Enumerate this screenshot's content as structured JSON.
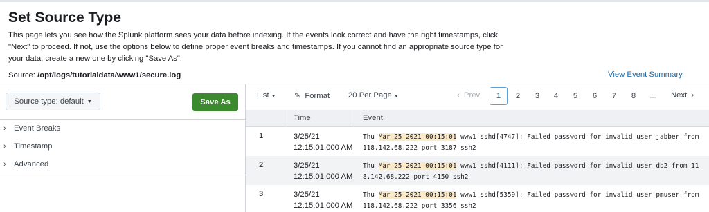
{
  "header": {
    "title": "Set Source Type",
    "description_lines": [
      "This page lets you see how the Splunk platform sees your data before indexing. If the events look correct and have the right timestamps, click",
      "\"Next\" to proceed. If not, use the options below to define proper event breaks and timestamps. If you cannot find an appropriate source type for",
      "your data, create a new one by clicking \"Save As\"."
    ],
    "source_label": "Source:",
    "source_path": "/opt/logs/tutorialdata/www1/secure.log",
    "view_summary_label": "View Event Summary"
  },
  "left_panel": {
    "source_type_label": "Source type: default",
    "save_as_label": "Save As",
    "accordion": [
      {
        "label": "Event Breaks"
      },
      {
        "label": "Timestamp"
      },
      {
        "label": "Advanced"
      }
    ]
  },
  "toolbar": {
    "list_label": "List",
    "format_label": "Format",
    "per_page_label": "20 Per Page",
    "prev_label": "Prev",
    "pages": [
      "1",
      "2",
      "3",
      "4",
      "5",
      "6",
      "7",
      "8"
    ],
    "ellipsis": "...",
    "next_label": "Next",
    "active_page": "1"
  },
  "table": {
    "columns": [
      "Time",
      "Event"
    ],
    "rows": [
      {
        "index": "1",
        "time_date": "3/25/21",
        "time_clock": "12:15:01.000 AM",
        "event_prefix": "Thu ",
        "event_timestamp": "Mar 25 2021 00:15:01",
        "event_rest_line1": " www1 sshd[4747]: Failed password for invalid user jabber from",
        "event_line2": "118.142.68.222 port 3187 ssh2"
      },
      {
        "index": "2",
        "time_date": "3/25/21",
        "time_clock": "12:15:01.000 AM",
        "event_prefix": "Thu ",
        "event_timestamp": "Mar 25 2021 00:15:01",
        "event_rest_line1": " www1 sshd[4111]: Failed password for invalid user db2 from 11",
        "event_line2": "8.142.68.222 port 4150 ssh2"
      },
      {
        "index": "3",
        "time_date": "3/25/21",
        "time_clock": "12:15:01.000 AM",
        "event_prefix": "Thu ",
        "event_timestamp": "Mar 25 2021 00:15:01",
        "event_rest_line1": " www1 sshd[5359]: Failed password for invalid user pmuser from",
        "event_line2": "118.142.68.222 port 3356 ssh2"
      }
    ]
  },
  "colors": {
    "primary_button": "#3c8a2e",
    "link": "#1d6fae",
    "timestamp_highlight": "#fbe9c8",
    "header_bg": "#eef0f3"
  },
  "icons": {
    "format": "pencil-icon",
    "caret": "caret-down-icon",
    "accordion": "chevron-right-icon"
  }
}
